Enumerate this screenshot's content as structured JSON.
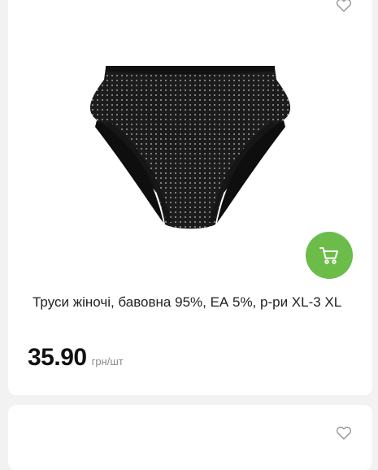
{
  "product": {
    "title": "Труси жіночі, бавовна 95%, ЕА 5%, р-ри XL-3 XL",
    "price": "35.90",
    "unit": "грн/шт",
    "image_alt": "black-dotted-briefs"
  },
  "icons": {
    "favorite": "heart-outline-icon",
    "cart": "shopping-cart-icon"
  },
  "colors": {
    "accent": "#6cbc4a",
    "background": "#f2f2f2",
    "card": "#ffffff"
  }
}
